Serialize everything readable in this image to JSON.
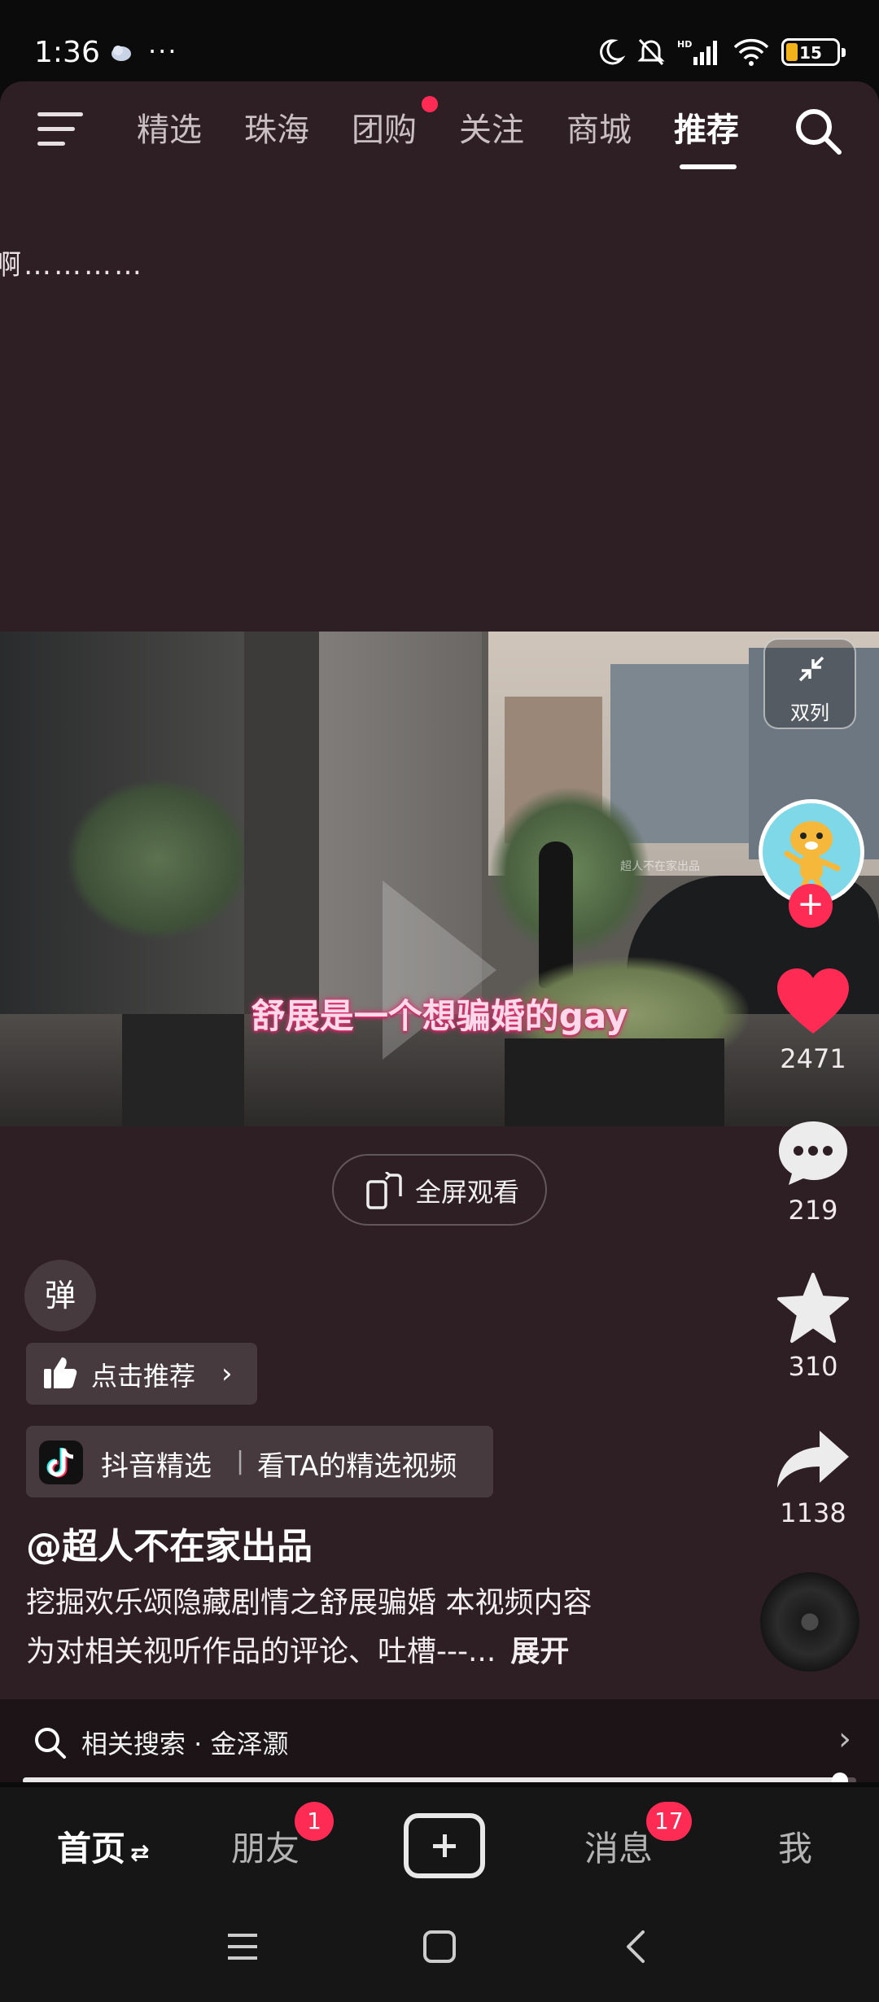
{
  "status_bar": {
    "time": "1:36",
    "dots": "···",
    "battery": "15",
    "icons": [
      "cloud-icon",
      "moon-icon",
      "bell-off-icon",
      "hd-signal-icon",
      "wifi-icon",
      "battery-icon"
    ]
  },
  "top_nav": {
    "tabs": [
      {
        "label": "精选",
        "active": false
      },
      {
        "label": "珠海",
        "active": false
      },
      {
        "label": "团购",
        "active": false,
        "dot": true
      },
      {
        "label": "关注",
        "active": false
      },
      {
        "label": "商城",
        "active": false
      },
      {
        "label": "推荐",
        "active": true
      }
    ]
  },
  "overflow_text": "啊…………",
  "video": {
    "caption": "舒展是一个想骗婚的gay",
    "watermark": "超人不在家出品",
    "dual_label": "双列"
  },
  "actions": {
    "likes": "2471",
    "comments": "219",
    "favorites": "310",
    "shares": "1138"
  },
  "fullscreen_label": "全屏观看",
  "danmu_label": "弹",
  "recommend_label": "点击推荐",
  "douyin_tag": {
    "title": "抖音精选",
    "separator": "|",
    "link": "看TA的精选视频"
  },
  "author": "@超人不在家出品",
  "description": {
    "line1": "挖掘欢乐颂隐藏剧情之舒展骗婚 本视频内容",
    "line2": "为对相关视听作品的评论、吐槽---...",
    "more": "展开"
  },
  "related_search": "相关搜索 · 金泽灏",
  "progress": 0.98,
  "bottom_nav": {
    "home": "首页",
    "home_suffix": "⇄",
    "friends": "朋友",
    "friends_badge": "1",
    "messages": "消息",
    "messages_badge": "17",
    "me": "我"
  },
  "colors": {
    "accent": "#fe2c55",
    "background": "#2e1f25",
    "caption_glow": "#d8336e"
  }
}
